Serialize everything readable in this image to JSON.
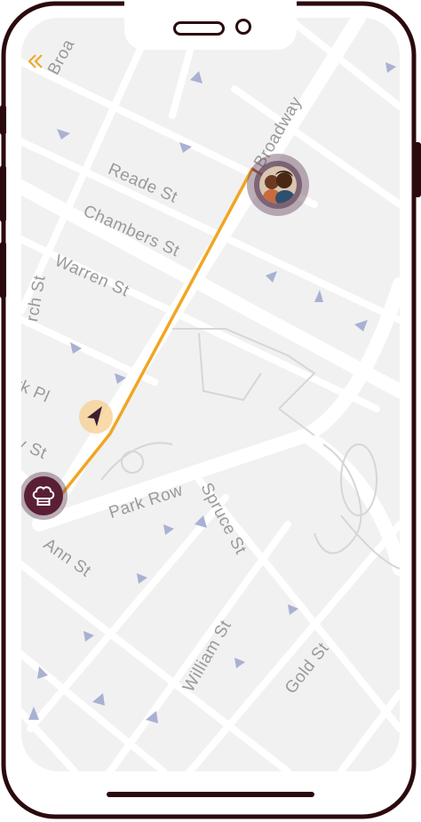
{
  "map": {
    "streets": [
      {
        "name": "Broadway"
      },
      {
        "name": "Reade St"
      },
      {
        "name": "Chambers St"
      },
      {
        "name": "Warren St"
      },
      {
        "name": "Park Row"
      },
      {
        "name": "Spruce St"
      },
      {
        "name": "Ann St"
      },
      {
        "name": "William St"
      },
      {
        "name": "Gold St"
      },
      {
        "name": "Broa"
      },
      {
        "name": "rch St"
      },
      {
        "name": "rk Pl"
      },
      {
        "name": "y St"
      }
    ],
    "route_color": "#f0a623",
    "map_bg_color": "#f1f1f2",
    "road_color": "#ffffff"
  },
  "markers": {
    "restaurant_icon": "chef-hat-icon",
    "courier_icon": "navigation-arrow-icon",
    "customer_icon": "customer-avatar",
    "marker_color": "#5a1f35",
    "courier_halo_color": "#f7ce8c"
  },
  "phone": {
    "frame_color": "#2b0a0e"
  }
}
